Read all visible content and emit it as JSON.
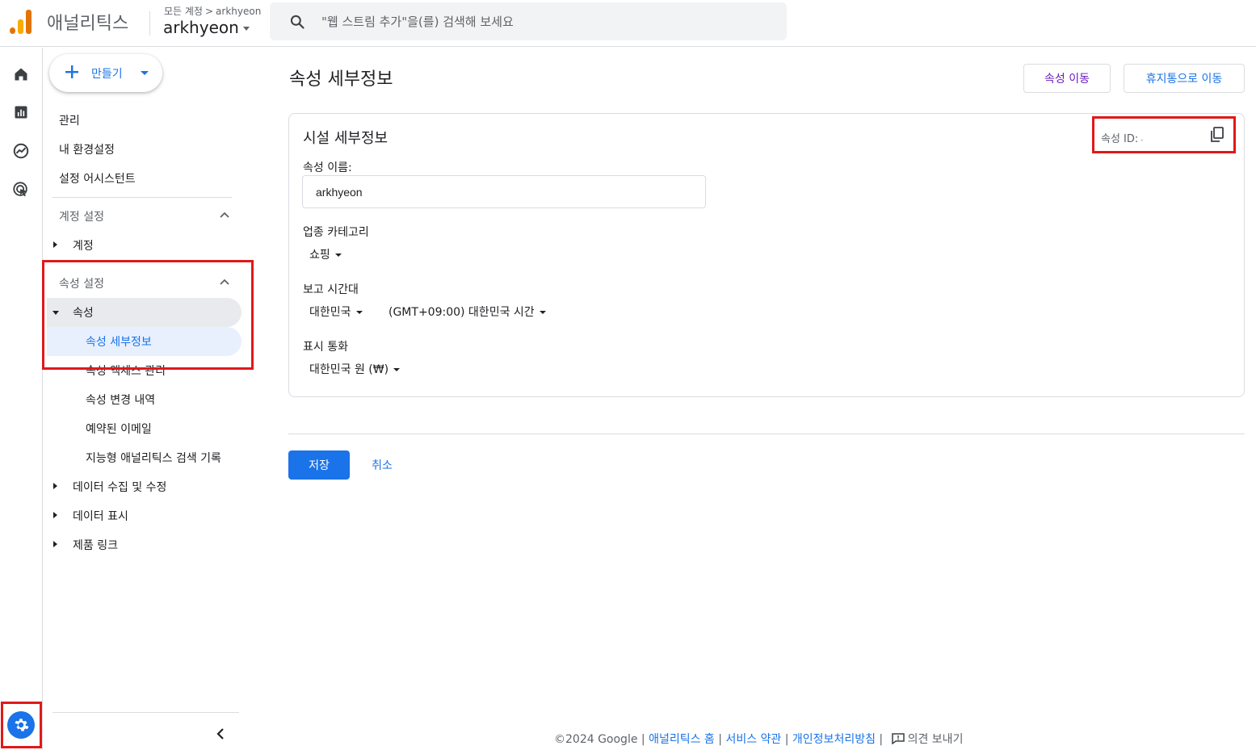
{
  "header": {
    "app_name": "애널리틱스",
    "breadcrumb_root": "모든 계정",
    "breadcrumb_sep": ">",
    "breadcrumb_account": "arkhyeon",
    "account_name": "arkhyeon",
    "search_placeholder": "\"웹 스트림 추가\"을(를) 검색해 보세요"
  },
  "rail": {
    "icons": [
      "home-icon",
      "reports-icon",
      "explore-icon",
      "advertising-icon"
    ],
    "admin_icon": "gear-icon"
  },
  "nav": {
    "create_label": "만들기",
    "top_items": [
      "관리",
      "내 환경설정",
      "설정 어시스턴트"
    ],
    "account_section": "계정 설정",
    "account_item": "계정",
    "property_section": "속성 설정",
    "property_item": "속성",
    "property_children": [
      "속성 세부정보",
      "속성 액세스 관리",
      "속성 변경 내역",
      "예약된 이메일",
      "지능형 애널리틱스 검색 기록"
    ],
    "other_items": [
      "데이터 수집 및 수정",
      "데이터 표시",
      "제품 링크"
    ]
  },
  "main": {
    "title": "속성 세부정보",
    "move_button": "속성 이동",
    "trash_button": "휴지통으로 이동",
    "card_title": "시설 세부정보",
    "property_id_label": "속성 ID:",
    "property_id_value": "-",
    "property_name_label": "속성 이름:",
    "property_name_value": "arkhyeon",
    "industry_label": "업종 카테고리",
    "industry_value": "쇼핑",
    "timezone_label": "보고 시간대",
    "timezone_country": "대한민국",
    "timezone_value": "(GMT+09:00) 대한민국 시간",
    "currency_label": "표시 통화",
    "currency_value": "대한민국 원 (₩)",
    "save_button": "저장",
    "cancel_button": "취소"
  },
  "footer": {
    "copyright": "©2024 Google",
    "links": [
      "애널리틱스 홈",
      "서비스 약관",
      "개인정보처리방침"
    ],
    "separator": "|",
    "feedback": "의견 보내기"
  },
  "colors": {
    "accent": "#1a73e8",
    "highlight_box": "#e01919",
    "selected_bg": "#e8f0fe",
    "logo_orange": "#f9ab00",
    "logo_dark_orange": "#e37400"
  }
}
